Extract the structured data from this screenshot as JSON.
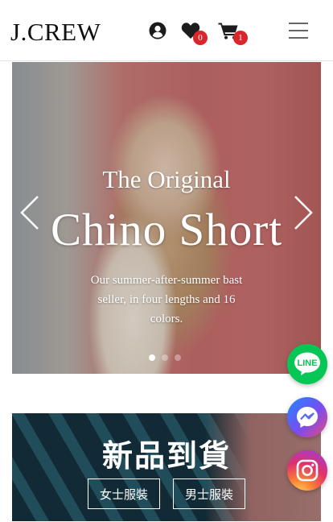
{
  "header": {
    "logo": "J.CREW",
    "icons": [
      "user-icon",
      "heart-icon",
      "cart-icon",
      "menu-icon"
    ],
    "wishlist_count": "0",
    "cart_count": "1"
  },
  "hero": {
    "eyebrow": "The Original",
    "title": "Chino Short",
    "subtitle": "Our summer-after-summer bast seller, in four lengths and 16 colors.",
    "slide_count": 3,
    "active_slide": 1
  },
  "banner": {
    "title": "新品到貨",
    "women_label": "女士服裝",
    "men_label": "男士服裝"
  },
  "social": {
    "line_label": "LINE",
    "icons": [
      "line-icon",
      "messenger-icon",
      "instagram-icon"
    ]
  },
  "colors": {
    "badge": "#d9262b",
    "line_green": "#06c755"
  }
}
